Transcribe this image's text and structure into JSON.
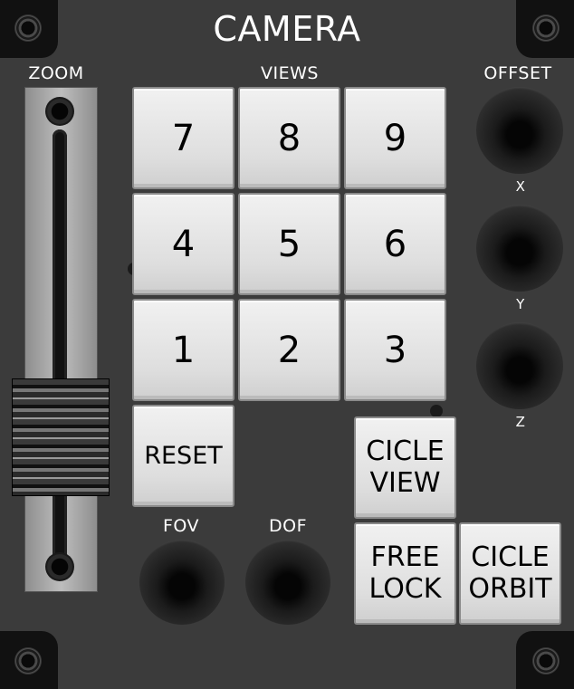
{
  "panel": {
    "title": "CAMERA",
    "zoom_label": "ZOOM",
    "views_label": "VIEWS",
    "offset_label": "OFFSET",
    "fov_label": "FOV",
    "dof_label": "DOF",
    "axis_x": "X",
    "axis_y": "Y",
    "axis_z": "Z"
  },
  "keypad": {
    "k7": "7",
    "k8": "8",
    "k9": "9",
    "k4": "4",
    "k5": "5",
    "k6": "6",
    "k1": "1",
    "k2": "2",
    "k3": "3",
    "reset": "RESET"
  },
  "buttons": {
    "cicle_view_1": "CICLE",
    "cicle_view_2": "VIEW",
    "free_lock_1": "FREE",
    "free_lock_2": "LOCK",
    "cicle_orbit_1": "CICLE",
    "cicle_orbit_2": "ORBIT"
  },
  "zoom": {
    "level": 0.25
  },
  "colors": {
    "panel": "#3b3b3b",
    "button": "#e6e6e6",
    "text": "#ffffff"
  },
  "icons": [
    "screw-icon"
  ]
}
